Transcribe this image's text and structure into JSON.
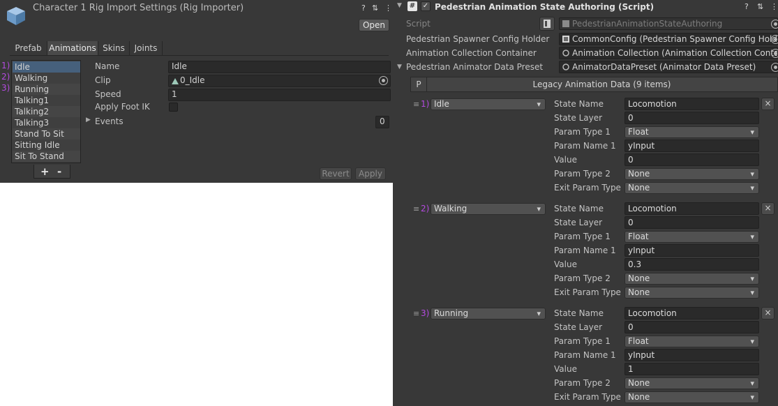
{
  "left": {
    "title": "Character 1 Rig Import Settings (Rig Importer)",
    "header_icons": {
      "help": "?",
      "settings": "⇅",
      "menu": "⋮"
    },
    "open_label": "Open",
    "tabs": [
      "Prefab",
      "Animations",
      "Skins",
      "Joints"
    ],
    "active_tab": "Animations",
    "clips": [
      "Idle",
      "Walking",
      "Running",
      "Talking1",
      "Talking2",
      "Talking3",
      "Stand To Sit",
      "Sitting Idle",
      "Sit To Stand"
    ],
    "numbers": [
      "1)",
      "2)",
      "3)"
    ],
    "props": {
      "name_label": "Name",
      "name_value": "Idle",
      "clip_label": "Clip",
      "clip_value": "0_Idle",
      "speed_label": "Speed",
      "speed_value": "1",
      "footik_label": "Apply Foot IK",
      "events_label": "Events",
      "events_count": "0"
    },
    "add_label": "+",
    "remove_label": "-",
    "revert_label": "Revert",
    "apply_label": "Apply"
  },
  "right": {
    "title": "Pedestrian Animation State Authoring (Script)",
    "script_label": "Script",
    "script_value": "PedestrianAnimationStateAuthoring",
    "fields": [
      {
        "label": "Pedestrian Spawner Config Holder",
        "value": "CommonConfig (Pedestrian Spawner Config Holde"
      },
      {
        "label": "Animation Collection Container",
        "value": "Animation Collection (Animation Collection Contai"
      },
      {
        "label": "Pedestrian Animator Data Preset",
        "value": "AnimatorDataPreset (Animator Data Preset)"
      }
    ],
    "list_header": "Legacy Animation Data (9 items)",
    "p_label": "P",
    "entries": [
      {
        "num": "1)",
        "name": "Idle",
        "rows": [
          {
            "label": "State Name",
            "value": "Locomotion",
            "kind": "text"
          },
          {
            "label": "State Layer",
            "value": "0",
            "kind": "text"
          },
          {
            "label": "Param Type 1",
            "value": "Float",
            "kind": "dd"
          },
          {
            "label": "Param Name 1",
            "value": "yInput",
            "kind": "text"
          },
          {
            "label": "Value",
            "value": "0",
            "kind": "text"
          },
          {
            "label": "Param Type 2",
            "value": "None",
            "kind": "dd"
          },
          {
            "label": "Exit Param Type",
            "value": "None",
            "kind": "dd"
          }
        ]
      },
      {
        "num": "2)",
        "name": "Walking",
        "rows": [
          {
            "label": "State Name",
            "value": "Locomotion",
            "kind": "text"
          },
          {
            "label": "State Layer",
            "value": "0",
            "kind": "text"
          },
          {
            "label": "Param Type 1",
            "value": "Float",
            "kind": "dd"
          },
          {
            "label": "Param Name 1",
            "value": "yInput",
            "kind": "text"
          },
          {
            "label": "Value",
            "value": "0.3",
            "kind": "text"
          },
          {
            "label": "Param Type 2",
            "value": "None",
            "kind": "dd"
          },
          {
            "label": "Exit Param Type",
            "value": "None",
            "kind": "dd"
          }
        ]
      },
      {
        "num": "3)",
        "name": "Running",
        "rows": [
          {
            "label": "State Name",
            "value": "Locomotion",
            "kind": "text"
          },
          {
            "label": "State Layer",
            "value": "0",
            "kind": "text"
          },
          {
            "label": "Param Type 1",
            "value": "Float",
            "kind": "dd"
          },
          {
            "label": "Param Name 1",
            "value": "yInput",
            "kind": "text"
          },
          {
            "label": "Value",
            "value": "1",
            "kind": "text"
          },
          {
            "label": "Param Type 2",
            "value": "None",
            "kind": "dd"
          },
          {
            "label": "Exit Param Type",
            "value": "None",
            "kind": "dd"
          }
        ]
      }
    ],
    "remove_glyph": "×"
  },
  "colors": {
    "accent": "#b44be0",
    "selection": "#46607c",
    "panel": "#383838"
  }
}
